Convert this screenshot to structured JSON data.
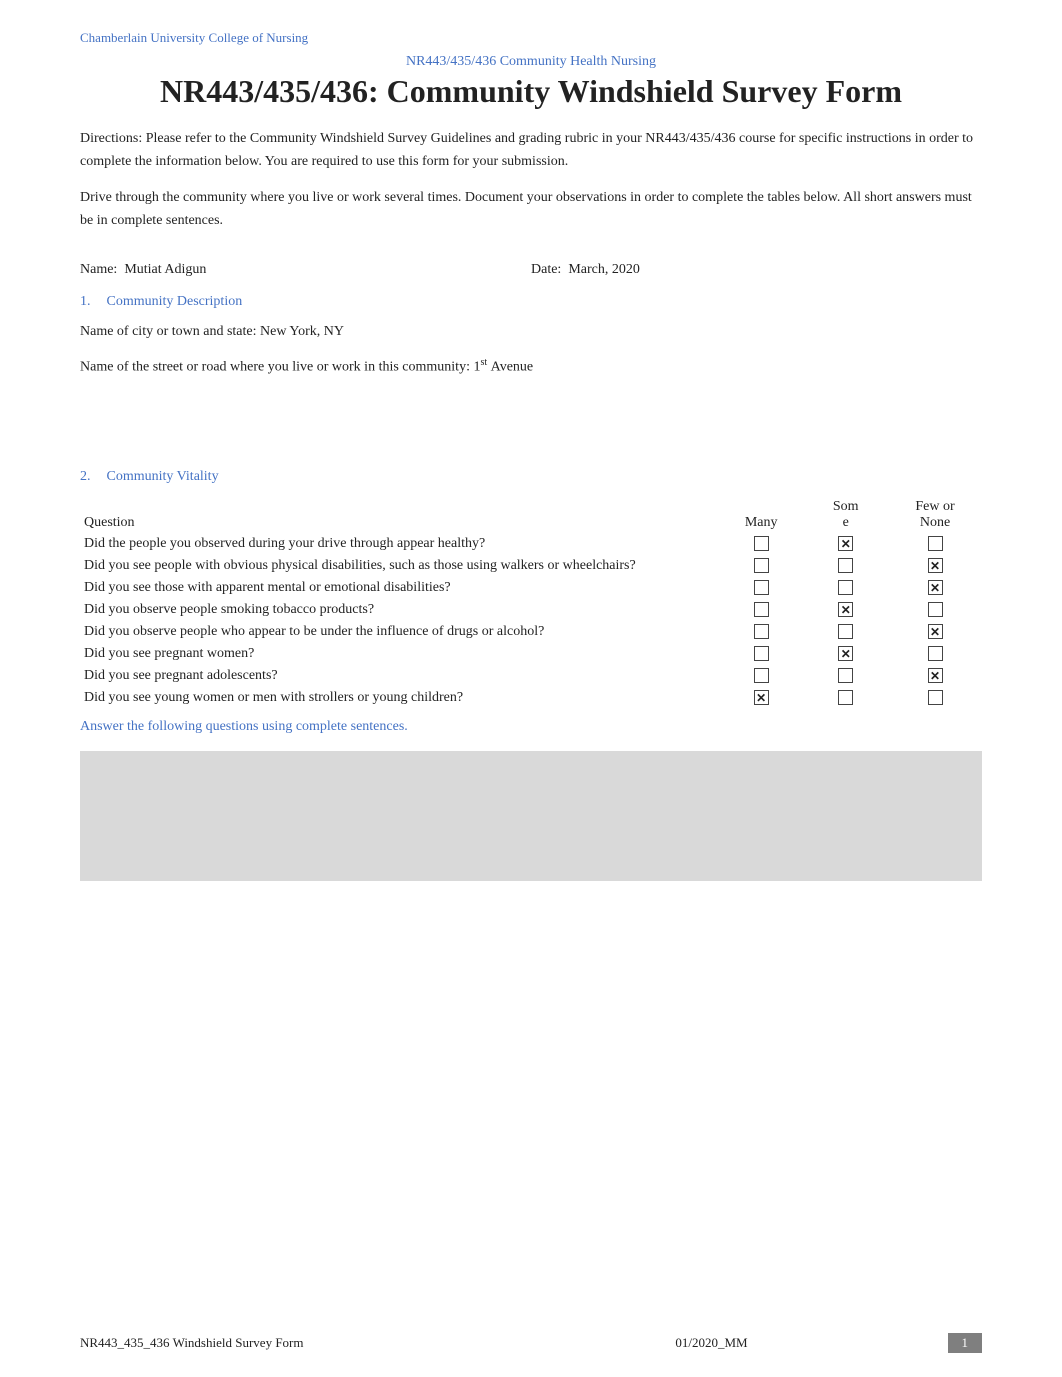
{
  "header": {
    "university": "Chamberlain University College of Nursing",
    "subtitle": "NR443/435/436 Community Health Nursing",
    "main_title": "NR443/435/436: Community Windshield Survey Form"
  },
  "directions": {
    "para1": "Directions: Please refer to the Community Windshield Survey Guidelines and grading rubric in your NR443/435/436 course for specific instructions in order to complete the information below. You are required to use this form for your submission.",
    "para2": "Drive through the community where you live or work several times. Document your observations in order to complete the tables below. All short answers must be in complete sentences."
  },
  "student": {
    "name_label": "Name:",
    "name_value": "Mutiat Adigun",
    "date_label": "Date:",
    "date_value": "March, 2020"
  },
  "section1": {
    "number": "1.",
    "title": "Community Description",
    "city_label": "Name of city or town and state:",
    "city_value": "New York, NY",
    "street_label": "Name of the street or road where you live or work in this community:",
    "street_value": "1",
    "street_suffix": "st",
    "street_end": "Avenue"
  },
  "section2": {
    "number": "2.",
    "title": "Community Vitality",
    "table_headers": {
      "question": "Question",
      "many": "Many",
      "some": "Som\ne",
      "few": "Few or\nNone"
    },
    "rows": [
      {
        "question": "Did the people you observed during your drive through appear healthy?",
        "many": false,
        "some": true,
        "few": false
      },
      {
        "question": "Did you see people with obvious physical disabilities, such as those using walkers or wheelchairs?",
        "many": false,
        "some": false,
        "few": true
      },
      {
        "question": "Did you see those with apparent mental or emotional disabilities?",
        "many": false,
        "some": false,
        "few": true
      },
      {
        "question": "Did you observe people smoking tobacco products?",
        "many": false,
        "some": true,
        "few": false
      },
      {
        "question": "Did you observe people who appear to be under the influence of drugs or alcohol?",
        "many": false,
        "some": false,
        "few": true
      },
      {
        "question": "Did you see pregnant women?",
        "many": false,
        "some": true,
        "few": false
      },
      {
        "question": "Did you see pregnant adolescents?",
        "many": false,
        "some": false,
        "few": true
      },
      {
        "question": "Did you see young women or men with strollers or young children?",
        "many": true,
        "some": false,
        "few": false
      }
    ],
    "answer_note": "Answer the following questions using complete sentences."
  },
  "footer": {
    "left": "NR443_435_436 Windshield Survey Form",
    "center": "01/2020_MM",
    "page": "1"
  }
}
